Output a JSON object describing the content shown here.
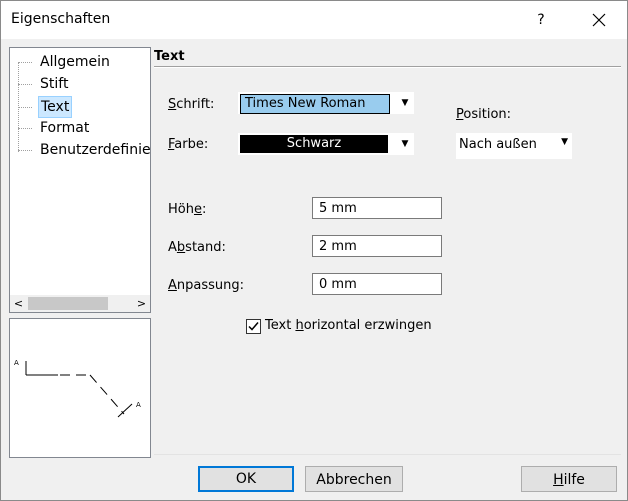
{
  "window": {
    "title": "Eigenschaften",
    "help_glyph": "?"
  },
  "tree": {
    "items": [
      {
        "label": "Allgemein",
        "selected": false
      },
      {
        "label": "Stift",
        "selected": false
      },
      {
        "label": "Text",
        "selected": true
      },
      {
        "label": "Format",
        "selected": false
      },
      {
        "label": "Benutzerdefinier",
        "selected": false
      }
    ],
    "scroll_left": "<",
    "scroll_right": ">"
  },
  "preview": {
    "marker_top": "A",
    "marker_bottom": "A"
  },
  "section": {
    "title": "Text"
  },
  "fields": {
    "schrift_label_ul": "S",
    "schrift_label_rest": "chrift:",
    "schrift_value": "Times New Roman",
    "farbe_label_ul": "F",
    "farbe_label_rest": "arbe:",
    "farbe_value": "Schwarz",
    "position_label_ul": "P",
    "position_label_rest": "osition:",
    "position_value": "Nach außen",
    "hoehe_label_pre": "Höh",
    "hoehe_label_ul": "e",
    "hoehe_label_post": ":",
    "hoehe_value": "5 mm",
    "abstand_label_pre": "A",
    "abstand_label_ul": "b",
    "abstand_label_post": "stand:",
    "abstand_value": "2 mm",
    "anpassung_label_ul": "A",
    "anpassung_label_rest": "npassung:",
    "anpassung_value": "0 mm",
    "checkbox_label_pre": "Text ",
    "checkbox_label_ul": "h",
    "checkbox_label_post": "orizontal erzwingen",
    "checkbox_checked": true
  },
  "buttons": {
    "ok": "OK",
    "cancel": "Abbrechen",
    "help_ul": "H",
    "help_rest": "ilfe"
  },
  "colors": {
    "selection": "#cce8ff",
    "font_swatch": "#99ccee",
    "color_swatch": "#000000"
  }
}
